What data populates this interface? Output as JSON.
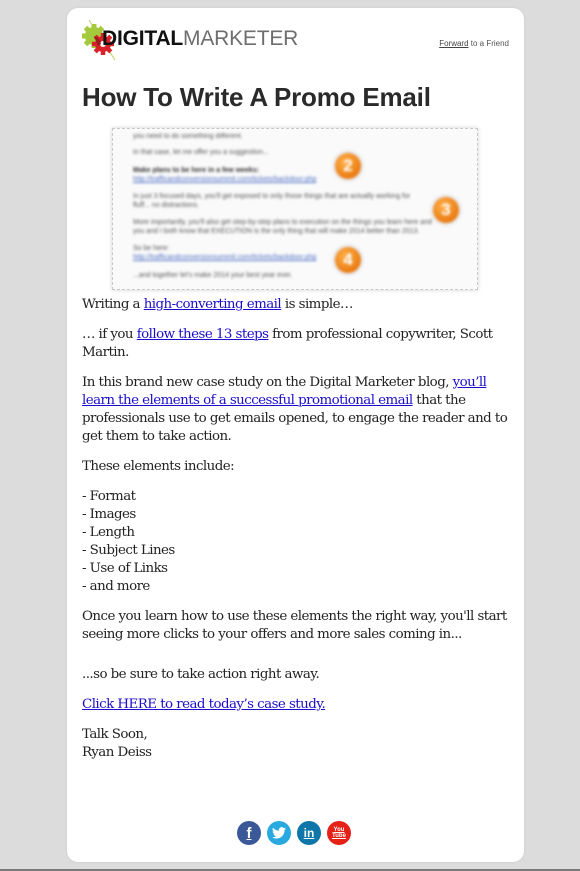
{
  "header": {
    "logo_bold": "DIGITAL",
    "logo_light": "MARKETER",
    "forward_link": "Forward",
    "forward_rest": " to a Friend"
  },
  "title": "How To Write A Promo Email",
  "hero_image": {
    "alt": "Blurred promo email screenshot with numbered callouts",
    "lines": [
      "you need to do something different.",
      "In that case, let me offer you a suggestion...",
      "Make plans to be here in a few weeks:",
      "http://trafficandconversionsummit.com/tickets/backdoor.php",
      "In just 3 focused days, you'll get exposed to only those things that are actually working for",
      "fluff... no distractions.",
      "More importantly, you'll also get step-by-step plans to execution on the things you learn here and",
      "you and I both know that EXECUTION is the only thing that will make 2014 better than 2013.",
      "So be here:",
      "http://trafficandconversionsummit.com/tickets/backdoor.php",
      "...and together let's make 2014 your best year ever."
    ],
    "badges": [
      "2",
      "3",
      "4"
    ],
    "badge_color": "#ea7b12"
  },
  "content": {
    "p1_pre": "Writing a ",
    "p1_link": "high-converting email",
    "p1_post": " is simple…",
    "p2_pre": "… if you ",
    "p2_link": "follow these 13 steps",
    "p2_post": " from professional copywriter, Scott Martin.",
    "p3_pre": "In this brand new case study on the Digital Marketer blog, ",
    "p3_link": "you’ll learn the elements of a successful promotional email",
    "p3_post": " that the professionals use to get emails opened, to engage the reader and to get them to take action.",
    "p4": "These elements include:",
    "list": [
      "- Format",
      "- Images",
      "- Length",
      "- Subject Lines",
      "- Use of Links",
      "- and more"
    ],
    "p5": "Once you learn how to use these elements the right way, you'll start seeing more clicks to your offers and more sales coming in...",
    "p6": "...so be sure to take action right away.",
    "cta_link": "Click HERE to read today’s case study.",
    "signoff": "Talk Soon,",
    "signature": "Ryan Deiss"
  },
  "social": [
    {
      "name": "facebook",
      "glyph": "f",
      "color": "#3b5998"
    },
    {
      "name": "twitter",
      "glyph": "t",
      "color": "#2aa9e0"
    },
    {
      "name": "linkedin",
      "glyph": "in",
      "color": "#0e76a8"
    },
    {
      "name": "youtube",
      "glyph": "You Tube",
      "color": "#e62117"
    }
  ],
  "colors": {
    "link": "#1a0dcc",
    "background": "#dcdcdc",
    "card": "#ffffff",
    "logo_green": "#a4c93a",
    "logo_red": "#d8232a"
  }
}
